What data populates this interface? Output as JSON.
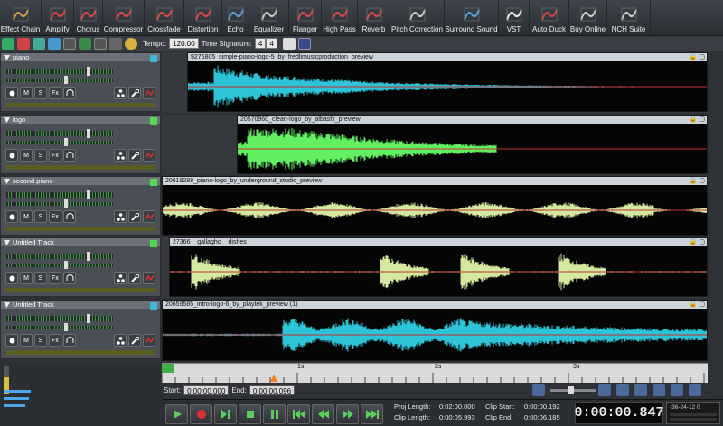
{
  "toolbar": {
    "items": [
      {
        "label": "Effect Chain",
        "icon": "effect-chain-icon",
        "w": 46,
        "color": "#d8a040"
      },
      {
        "label": "Amplify",
        "icon": "amplify-icon",
        "w": 36,
        "color": "#e04040"
      },
      {
        "label": "Chorus",
        "icon": "chorus-icon",
        "w": 32,
        "color": "#e04848"
      },
      {
        "label": "Compressor",
        "icon": "compressor-icon",
        "w": 46,
        "color": "#e04848"
      },
      {
        "label": "Crossfade",
        "icon": "crossfade-icon",
        "w": 44,
        "color": "#e04848"
      },
      {
        "label": "Distortion",
        "icon": "distortion-icon",
        "w": 42,
        "color": "#e04848"
      },
      {
        "label": "Echo",
        "icon": "echo-icon",
        "w": 30,
        "color": "#5aa8e0"
      },
      {
        "label": "Equalizer",
        "icon": "equalizer-icon",
        "w": 44,
        "color": "#cccccc"
      },
      {
        "label": "Flanger",
        "icon": "flanger-icon",
        "w": 36,
        "color": "#e04848"
      },
      {
        "label": "High Pass",
        "icon": "high-pass-icon",
        "w": 40,
        "color": "#e04848"
      },
      {
        "label": "Reverb",
        "icon": "reverb-icon",
        "w": 36,
        "color": "#e04848"
      },
      {
        "label": "Pitch Correction",
        "icon": "pitch-correction-icon",
        "w": 60,
        "color": "#cccccc"
      },
      {
        "label": "Surround Sound",
        "icon": "surround-sound-icon",
        "w": 60,
        "color": "#5aa8e0"
      },
      {
        "label": "VST",
        "icon": "vst-icon",
        "w": 34,
        "color": "#eeeeee"
      },
      {
        "label": "Auto Duck",
        "icon": "auto-duck-icon",
        "w": 44,
        "color": "#d84444"
      },
      {
        "label": "Buy Online",
        "icon": "buy-online-icon",
        "w": 42,
        "color": "#cccccc"
      },
      {
        "label": "NCH Suite",
        "icon": "nch-suite-icon",
        "w": 48,
        "color": "#cccccc"
      }
    ]
  },
  "tb2": {
    "tempo_label": "Tempo:",
    "tempo": "120.00",
    "ts_label": "Time Signature:",
    "ts_num": "4",
    "ts_den": "4"
  },
  "tracks": [
    {
      "name": "piano",
      "square": "#42b8d8"
    },
    {
      "name": "logo",
      "square": "#52d852"
    },
    {
      "name": "second piano",
      "square": "#52d852"
    },
    {
      "name": "Untitled Track",
      "square": "#52d852"
    },
    {
      "name": "Untitled Track",
      "square": "#42b8d8"
    }
  ],
  "track_buttons": {
    "m": "M",
    "s": "S",
    "fx": "Fx"
  },
  "clips": [
    {
      "name": "9276805_simple-piano-logo-5_by_fredlimusicproduction_preview",
      "color": "#2ec4d8",
      "icons": "🔒 ▢"
    },
    {
      "name": "20570960_clean-logo_by_albasfx_preview",
      "color": "#62f062",
      "icons": "🔒 ▢"
    },
    {
      "name": "20618288_piano-logo_by_underground_studio_preview",
      "color": "#d4e8a0",
      "icons": "🔒 ▢"
    },
    {
      "name": "27366__gallagho__dishes",
      "color": "#d4e8a0",
      "icons": "🔒 ▢"
    },
    {
      "name": "20659585_intro-logo-6_by_playtek_preview (1)",
      "color": "#2ec4d8",
      "icons": "🔒 ▢"
    }
  ],
  "timeline": {
    "ticks": [
      "1s",
      "2s",
      "3s"
    ]
  },
  "status": {
    "start_label": "Start:",
    "start": "0:00:00.000",
    "end_label": "End:",
    "end": "0:00:00.096"
  },
  "project": {
    "proj_length_label": "Proj Length:",
    "proj_length": "0:02:00.000",
    "clip_length_label": "Clip Length:",
    "clip_length": "0:00:05.993",
    "clip_start_label": "Clip Start:",
    "clip_start": "0:00:00.192",
    "clip_end_label": "Clip End:",
    "clip_end": "0:00:06.185",
    "counter": "0:00:00.847"
  },
  "meter": {
    "readout": "-36-24-12 0"
  }
}
